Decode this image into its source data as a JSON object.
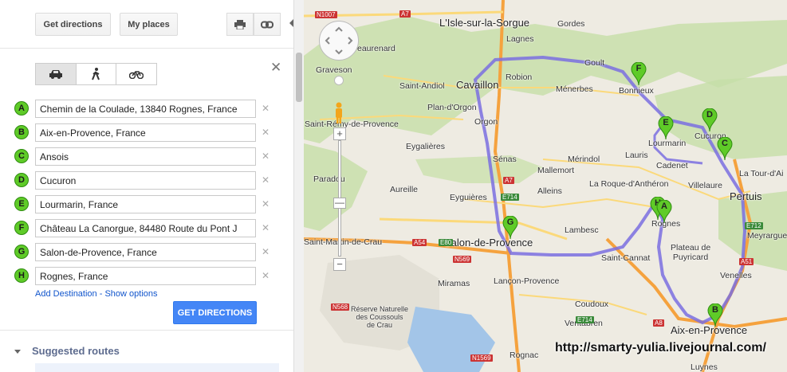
{
  "toolbar": {
    "get_directions_label": "Get directions",
    "my_places_label": "My places",
    "print_icon": "print-icon",
    "link_icon": "link-icon"
  },
  "travel_modes": [
    "car-icon",
    "walk-icon",
    "bike-icon"
  ],
  "waypoints": [
    {
      "letter": "A",
      "value": "Chemin de la Coulade, 13840 Rognes, France"
    },
    {
      "letter": "B",
      "value": "Aix-en-Provence, France"
    },
    {
      "letter": "C",
      "value": "Ansois"
    },
    {
      "letter": "D",
      "value": "Cucuron"
    },
    {
      "letter": "E",
      "value": "Lourmarin, France"
    },
    {
      "letter": "F",
      "value": "Château La Canorgue, 84480 Route du Pont J"
    },
    {
      "letter": "G",
      "value": "Salon-de-Provence, France"
    },
    {
      "letter": "H",
      "value": "Rognes, France"
    }
  ],
  "add_destination_label": "Add Destination",
  "separator_label": " - ",
  "show_options_label": "Show options",
  "get_directions_button": "GET DIRECTIONS",
  "suggested_routes_label": "Suggested routes",
  "colors": {
    "accent": "#4486f6",
    "route": "#7a6ee0",
    "marker": "#5fcb28",
    "forest": "#c6dfa7",
    "water": "#a3c5e8"
  },
  "map": {
    "places": [
      {
        "id": "lisle",
        "name": "L'Isle-sur-la-Sorgue"
      },
      {
        "id": "gordes",
        "name": "Gordes"
      },
      {
        "id": "lagnes",
        "name": "Lagnes"
      },
      {
        "id": "cavaillon",
        "name": "Cavaillon"
      },
      {
        "id": "robion",
        "name": "Robion"
      },
      {
        "id": "goult",
        "name": "Goult"
      },
      {
        "id": "beaurenard",
        "name": "eaurenard"
      },
      {
        "id": "graveson",
        "name": "Graveson"
      },
      {
        "id": "saintandiol",
        "name": "Saint-Andiol"
      },
      {
        "id": "menerbes",
        "name": "Ménerbes"
      },
      {
        "id": "bonnieux",
        "name": "Bonnieux"
      },
      {
        "id": "planorgon",
        "name": "Plan-d'Orgon"
      },
      {
        "id": "orgon",
        "name": "Orgon"
      },
      {
        "id": "saintremy",
        "name": "Saint-Rémy-de-Provence"
      },
      {
        "id": "eygalieres",
        "name": "Eygalières"
      },
      {
        "id": "lourmarin",
        "name": "Lourmarin"
      },
      {
        "id": "cucuron",
        "name": "Cucuron"
      },
      {
        "id": "lauris",
        "name": "Lauris"
      },
      {
        "id": "senas",
        "name": "Sénas"
      },
      {
        "id": "merindol",
        "name": "Mérindol"
      },
      {
        "id": "cadenet",
        "name": "Cadenet"
      },
      {
        "id": "tourdaigues",
        "name": "La Tour-d'Ai"
      },
      {
        "id": "villelaure",
        "name": "Villelaure"
      },
      {
        "id": "paradou",
        "name": "Paradou"
      },
      {
        "id": "mallemort",
        "name": "Mallemort"
      },
      {
        "id": "laroque",
        "name": "La Roque-d'Anthéron"
      },
      {
        "id": "aureille",
        "name": "Aureille"
      },
      {
        "id": "eyguieres",
        "name": "Eyguières"
      },
      {
        "id": "alleins",
        "name": "Alleins"
      },
      {
        "id": "pertuis",
        "name": "Pertuis"
      },
      {
        "id": "rognes",
        "name": "Rognes"
      },
      {
        "id": "lambesc",
        "name": "Lambesc"
      },
      {
        "id": "meyrargues",
        "name": "Meyrargues"
      },
      {
        "id": "stmartin",
        "name": "Saint-Martin-de-Crau"
      },
      {
        "id": "salon",
        "name": "Salon-de-Provence"
      },
      {
        "id": "saintcannat",
        "name": "Saint-Cannat"
      },
      {
        "id": "plateau",
        "name": "Plateau de\nPuyricard"
      },
      {
        "id": "venelles",
        "name": "Venelles"
      },
      {
        "id": "miramas",
        "name": "Miramas"
      },
      {
        "id": "lancon",
        "name": "Lançon-Provence"
      },
      {
        "id": "reserve",
        "name": "Réserve Naturelle\ndes Coussouls\nde Crau"
      },
      {
        "id": "coudoux",
        "name": "Coudoux"
      },
      {
        "id": "ventabren",
        "name": "Ventabren"
      },
      {
        "id": "aix",
        "name": "Aix-en-Provence"
      },
      {
        "id": "rognac",
        "name": "Rognac"
      },
      {
        "id": "luynes",
        "name": "Luynes"
      }
    ],
    "roads": [
      {
        "id": "n1007",
        "name": "N1007"
      },
      {
        "id": "a7a",
        "name": "A7"
      },
      {
        "id": "a7b",
        "name": "A7"
      },
      {
        "id": "e714a",
        "name": "E714"
      },
      {
        "id": "a54",
        "name": "A54"
      },
      {
        "id": "e80",
        "name": "E80"
      },
      {
        "id": "n569",
        "name": "N569"
      },
      {
        "id": "n568",
        "name": "N568"
      },
      {
        "id": "e714b",
        "name": "E714"
      },
      {
        "id": "a8",
        "name": "A8"
      },
      {
        "id": "e712",
        "name": "E712"
      },
      {
        "id": "a51",
        "name": "A51"
      },
      {
        "id": "n1569",
        "name": "N1569"
      }
    ],
    "pins": [
      "A",
      "B",
      "C",
      "D",
      "E",
      "F",
      "G",
      "H"
    ],
    "credit": "http://smarty-yulia.livejournal.com/"
  }
}
